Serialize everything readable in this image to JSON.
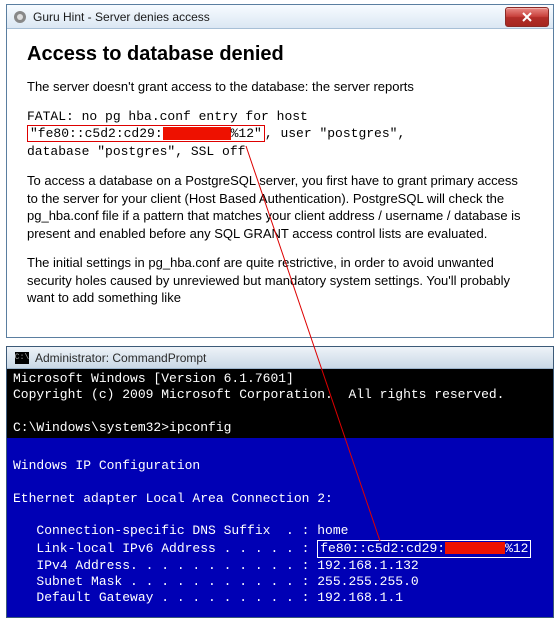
{
  "guru": {
    "window_title": "Guru Hint - Server denies access",
    "heading": "Access to database denied",
    "intro": "The server doesn't grant access to the database: the server reports",
    "fatal_line1": "FATAL: no pg hba.conf entry for host",
    "fatal_addr_prefix": "\"fe80::c5d2:cd29:",
    "fatal_addr_suffix": "%12\"",
    "fatal_tail": ", user \"postgres\",",
    "fatal_line3": "database \"postgres\", SSL off",
    "para2": "To access a database on a PostgreSQL server, you first have to grant primary access to the server for your client (Host Based Authentication). PostgreSQL will check the pg_hba.conf file if a pattern that matches your client address / username / database is present and enabled before any SQL GRANT access control lists are evaluated.",
    "para3": "The initial settings in pg_hba.conf are quite restrictive, in order to avoid unwanted security holes caused by unreviewed but mandatory system settings. You'll probably want to add something like"
  },
  "cmd": {
    "window_title": "Administrator: CommandPrompt",
    "line_ver": "Microsoft Windows [Version 6.1.7601]",
    "line_copy": "Copyright (c) 2009 Microsoft Corporation.  All rights reserved.",
    "prompt": "C:\\Windows\\system32>ipconfig",
    "heading": "Windows IP Configuration",
    "adapter": "Ethernet adapter Local Area Connection 2:",
    "dns_label": "   Connection-specific DNS Suffix  . : ",
    "dns_value": "home",
    "ll_label": "   Link-local IPv6 Address . . . . . : ",
    "ll_value_prefix": "fe80::c5d2:cd29:",
    "ll_value_suffix": "%12",
    "ipv4_label": "   IPv4 Address. . . . . . . . . . . : ",
    "ipv4_value": "192.168.1.132",
    "mask_label": "   Subnet Mask . . . . . . . . . . . : ",
    "mask_value": "255.255.255.0",
    "gw_label": "   Default Gateway . . . . . . . . . : ",
    "gw_value": "192.168.1.1"
  }
}
